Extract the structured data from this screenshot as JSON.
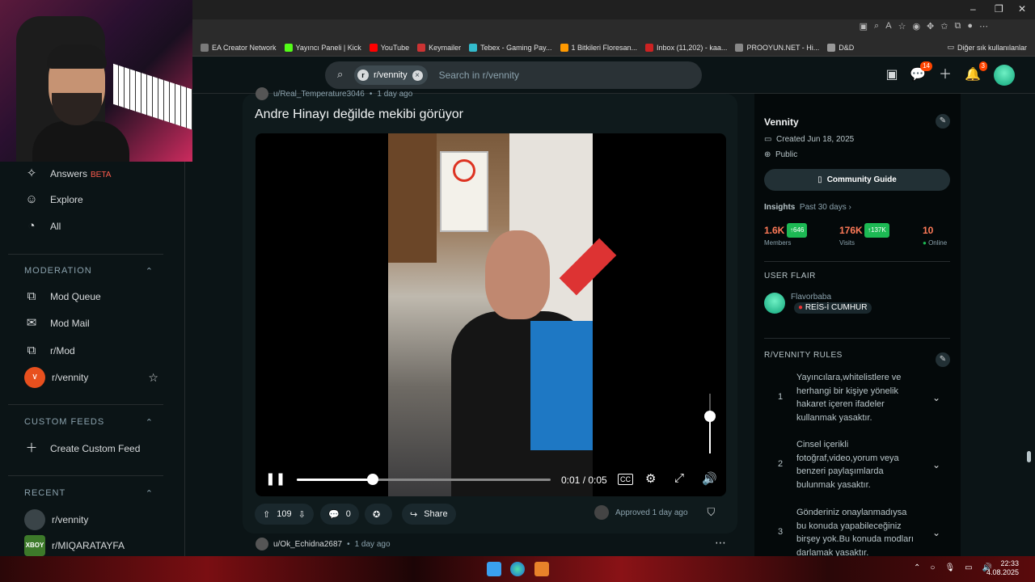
{
  "bookmarks": [
    {
      "label": "EA Creator Network",
      "icon": "ea-icon",
      "color": "#7a7a7a"
    },
    {
      "label": "Yayıncı Paneli | Kick",
      "icon": "kick-icon",
      "color": "#53fc18"
    },
    {
      "label": "YouTube",
      "icon": "youtube-icon",
      "color": "#ff0000"
    },
    {
      "label": "Keymailer",
      "icon": "keymailer-icon",
      "color": "#c33"
    },
    {
      "label": "Tebex - Gaming Pay...",
      "icon": "tebex-icon",
      "color": "#3bc"
    },
    {
      "label": "1 Bitkileri Floresan...",
      "icon": "site-icon",
      "color": "#f90"
    },
    {
      "label": "Inbox (11,202) - kaa...",
      "icon": "mail-icon",
      "color": "#c22"
    },
    {
      "label": "PROOYUN.NET - Hi...",
      "icon": "globe-icon",
      "color": "#888"
    },
    {
      "label": "D&D",
      "icon": "folder-icon",
      "color": "#999"
    }
  ],
  "other_bookmarks": "Diğer sık kullanılanlar",
  "search": {
    "chip": "r/vennity",
    "placeholder": "Search in r/vennity"
  },
  "header": {
    "chat_badge": "14",
    "notif_badge": "3"
  },
  "sidebar": {
    "top_items": [
      {
        "label": "Answers",
        "badge": "BETA",
        "icon": "answers-icon"
      },
      {
        "label": "Explore",
        "icon": "explore-icon"
      },
      {
        "label": "All",
        "icon": "all-icon"
      }
    ],
    "moderation_title": "MODERATION",
    "moderation_items": [
      {
        "label": "Mod Queue"
      },
      {
        "label": "Mod Mail"
      },
      {
        "label": "r/Mod"
      },
      {
        "label": "r/vennity"
      }
    ],
    "custom_feeds_title": "CUSTOM FEEDS",
    "create_custom_feed": "Create Custom Feed",
    "recent_title": "RECENT",
    "recent_items": [
      {
        "label": "r/vennity"
      },
      {
        "label": "r/MIQARATAYFA",
        "avatar_text": "XBOY"
      }
    ]
  },
  "post": {
    "author": "u/Real_Temperature3046",
    "time": "1 day ago",
    "title": "Andre Hinayı değilde mekibi görüyor",
    "video": {
      "time": "0:01 / 0:05",
      "progress": 0.3,
      "volume": 0.62
    },
    "votes": "109",
    "comments": "0",
    "share": "Share",
    "approved": "Approved 1 day ago"
  },
  "next_post": {
    "author": "u/Ok_Echidna2687",
    "time": "1 day ago"
  },
  "community": {
    "name": "Vennity",
    "created": "Created Jun 18, 2025",
    "visibility": "Public",
    "guide_button": "Community Guide",
    "insights_label": "Insights",
    "insights_range": "Past 30 days",
    "members": "1.6K",
    "members_delta": "646",
    "members_label": "Members",
    "visits": "176K",
    "visits_delta": "137K",
    "visits_label": "Visits",
    "online": "10",
    "online_label": "Online",
    "user_flair_title": "USER FLAIR",
    "flair_user": "Flavorbaba",
    "flair_text": "REİS-İ CUMHUR",
    "rules_title": "R/VENNITY RULES",
    "rules": [
      {
        "num": "1",
        "text": "Yayıncılara,whitelistlere ve herhangi bir kişiye yönelik hakaret içeren ifadeler kullanmak yasaktır."
      },
      {
        "num": "2",
        "text": "Cinsel içerikli fotoğraf,video,yorum veya benzeri paylaşımlarda bulunmak yasaktır."
      },
      {
        "num": "3",
        "text": "Gönderiniz onaylanmadıysa bu konuda yapabileceğiniz birşey yok.Bu konuda modları darlamak yasaktır."
      }
    ]
  },
  "clock": {
    "time": "22:33",
    "date": "4.08.2025"
  },
  "colors": {
    "accent": "#ff4500",
    "reddit_bg": "#0b1416",
    "green": "#1db954"
  }
}
